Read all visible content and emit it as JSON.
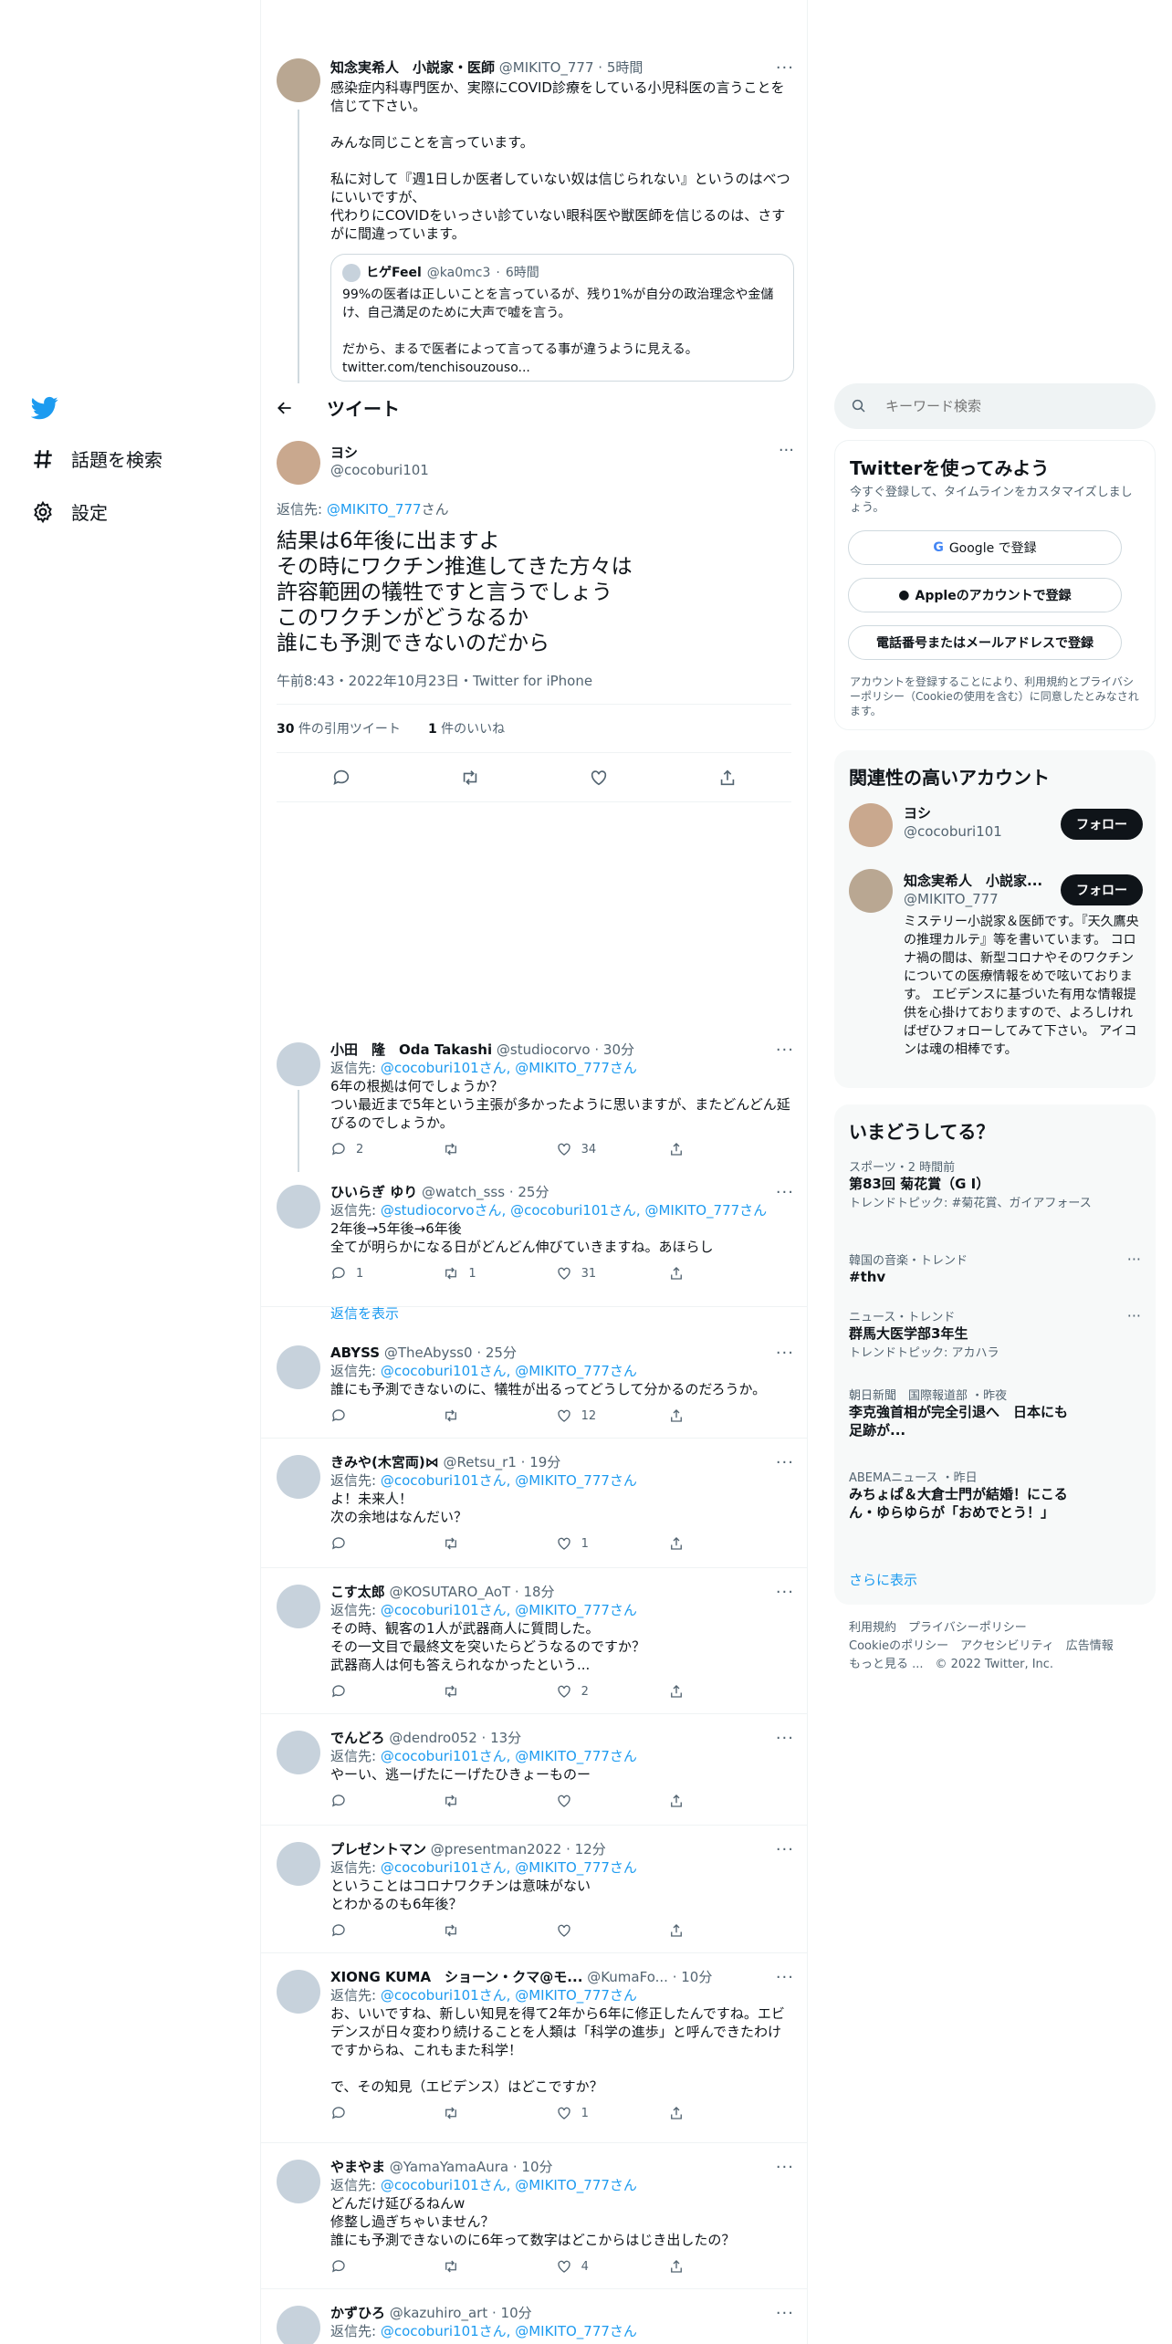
{
  "nav": {
    "explore_label": "話題を検索",
    "settings_label": "設定"
  },
  "header": {
    "title": "ツイート"
  },
  "quoted_parent": {
    "name": "知念実希人　小説家・医師",
    "handle": "@MIKITO_777",
    "time": "5時間",
    "text": "感染症内科専門医か、実際にCOVID診療をしている小児科医の言うことを信じて下さい。\n\nみんな同じことを言っています。\n\n私に対して『週1日しか医者していない奴は信じられない』というのはべつにいいですが、\n代わりにCOVIDをいっさい診ていない眼科医や獣医師を信じるのは、さすがに間違っています。",
    "quote": {
      "name": "ヒゲFeel",
      "handle": "@ka0mc3",
      "time": "6時間",
      "text": "99%の医者は正しいことを言っているが、残り1%が自分の政治理念や金儲け、自己満足のために大声で嘘を言う。\n\nだから、まるで医者によって言ってる事が違うように見える。\ntwitter.com/tenchisouzouso..."
    }
  },
  "main_tweet": {
    "name": "ヨシ",
    "handle": "@cocoburi101",
    "reply_prefix": "返信先: ",
    "reply_to": "@MIKITO_777",
    "reply_suffix": "さん",
    "text": "結果は6年後に出ますよ\nその時にワクチン推進してきた方々は\n許容範囲の犠牲ですと言うでしょう\nこのワクチンがどうなるか\n誰にも予測できないのだから",
    "timestamp": "午前8:43・2022年10月23日・Twitter for iPhone",
    "quote_count": "30",
    "quote_label": " 件の引用ツイート",
    "like_count": "1",
    "like_label": " 件のいいね"
  },
  "replies": [
    {
      "name": "小田　隆　Oda Takashi",
      "handle": "@studiocorvo",
      "time": "30分",
      "reply": "@cocoburi101さん, @MIKITO_777さん",
      "text": "6年の根拠は何でしょうか？\nつい最近まで5年という主張が多かったように思いますが、またどんどん延びるのでしょうか。",
      "replies": "2",
      "retweets": "",
      "likes": "34"
    },
    {
      "name": "ひいらぎ ゆり",
      "handle": "@watch_sss",
      "time": "25分",
      "reply": "@studiocorvoさん, @cocoburi101さん, @MIKITO_777さん",
      "text": "2年後→5年後→6年後\n全てが明らかになる日がどんどん伸びていきますね。あほらし",
      "replies": "1",
      "retweets": "1",
      "likes": "31"
    },
    {
      "name": "ABYSS",
      "handle": "@TheAbyss0",
      "time": "25分",
      "reply": "@cocoburi101さん, @MIKITO_777さん",
      "text": "誰にも予測できないのに、犠牲が出るってどうして分かるのだろうか。",
      "replies": "",
      "retweets": "",
      "likes": "12"
    },
    {
      "name": "きみや(木宮両)⋈",
      "handle": "@Retsu_r1",
      "time": "19分",
      "reply": "@cocoburi101さん, @MIKITO_777さん",
      "text": "よ！未来人！\n次の余地はなんだい？",
      "replies": "",
      "retweets": "",
      "likes": "1"
    },
    {
      "name": "こす太郎",
      "handle": "@KOSUTARO_AoT",
      "time": "18分",
      "reply": "@cocoburi101さん, @MIKITO_777さん",
      "text": "その時、観客の1人が武器商人に質問した。\nその一文目で最終文を突いたらどうなるのですか？\n武器商人は何も答えられなかったという...",
      "replies": "",
      "retweets": "",
      "likes": "2"
    },
    {
      "name": "でんどろ",
      "handle": "@dendro052",
      "time": "13分",
      "reply": "@cocoburi101さん, @MIKITO_777さん",
      "text": "やーい、逃ーげたにーげたひきょーものー",
      "replies": "",
      "retweets": "",
      "likes": ""
    },
    {
      "name": "プレゼントマン",
      "handle": "@presentman2022",
      "time": "12分",
      "reply": "@cocoburi101さん, @MIKITO_777さん",
      "text": "ということはコロナワクチンは意味がない\nとわかるのも6年後？",
      "replies": "",
      "retweets": "",
      "likes": ""
    },
    {
      "name": "XIONG KUMA　ショーン・クマ@モ...",
      "handle": "@KumaFo...",
      "time": "10分",
      "reply": "@cocoburi101さん, @MIKITO_777さん",
      "text": "お、いいですね、新しい知見を得て2年から6年に修正したんですね。エビデンスが日々変わり続けることを人類は「科学の進歩」と呼んできたわけですからね、これもまた科学！\n\nで、その知見（エビデンス）はどこですか？",
      "replies": "",
      "retweets": "",
      "likes": "1"
    },
    {
      "name": "やまやま",
      "handle": "@YamaYamaAura",
      "time": "10分",
      "reply": "@cocoburi101さん, @MIKITO_777さん",
      "text": "どんだけ延びるねんw\n修整し過ぎちゃいません？\n誰にも予測できないのに6年って数字はどこからはじき出したの？",
      "replies": "",
      "retweets": "",
      "likes": "4"
    },
    {
      "name": "かずひろ",
      "handle": "@kazuhiro_art",
      "time": "10分",
      "reply": "@cocoburi101さん, @MIKITO_777さん",
      "text": "",
      "replies": "",
      "retweets": "",
      "likes": ""
    }
  ],
  "show_replies_label": "返信を表示",
  "right": {
    "search_placeholder": "キーワード検索",
    "signup": {
      "title": "Twitterを使ってみよう",
      "sub": "今すぐ登録して、タイムラインをカスタマイズしましょう。",
      "google": "Google で登録",
      "apple": "Appleのアカウントで登録",
      "phone": "電話番号またはメールアドレスで登録",
      "terms": "アカウントを登録することにより、利用規約とプライバシーポリシー（Cookieの使用を含む）に同意したとみなされます。"
    },
    "related": {
      "title": "関連性の高いアカウント",
      "follow": "フォロー",
      "accounts": [
        {
          "name": "ヨシ",
          "handle": "@cocoburi101",
          "bio": ""
        },
        {
          "name": "知念実希人　小説家...",
          "handle": "@MIKITO_777",
          "bio": "ミステリー小説家＆医師です。『天久鷹央の推理カルテ』等を書いています。 コロナ禍の間は、新型コロナやそのワクチンについての医療情報をめで呟いております。 エビデンスに基づいた有用な情報提供を心掛けておりますので、よろしければぜひフォローしてみて下さい。 アイコンは魂の相棒です。"
        }
      ]
    },
    "trends": {
      "title": "いまどうしてる？",
      "items": [
        {
          "meta": "スポーツ・2 時間前",
          "name": "第83回 菊花賞（G I）",
          "sub": "トレンドトピック: #菊花賞、ガイアフォース"
        },
        {
          "meta": "韓国の音楽・トレンド",
          "name": "#thv",
          "sub": ""
        },
        {
          "meta": "ニュース・トレンド",
          "name": "群馬大医学部3年生",
          "sub": "トレンドトピック: アカハラ"
        },
        {
          "meta": "朝日新聞　国際報道部 ・昨夜",
          "name": "李克強首相が完全引退へ　日本にも足跡が...",
          "sub": ""
        },
        {
          "meta": "ABEMAニュース ・昨日",
          "name": "みちょぱ＆大倉士門が結婚！にこるん・ゆらゆらが「おめでとう！」",
          "sub": ""
        }
      ],
      "more": "さらに表示"
    },
    "footer": {
      "line1": "利用規約　プライバシーポリシー",
      "line2": "Cookieのポリシー　アクセシビリティ　広告情報",
      "line3": "もっと見る ...　© 2022 Twitter, Inc."
    }
  }
}
